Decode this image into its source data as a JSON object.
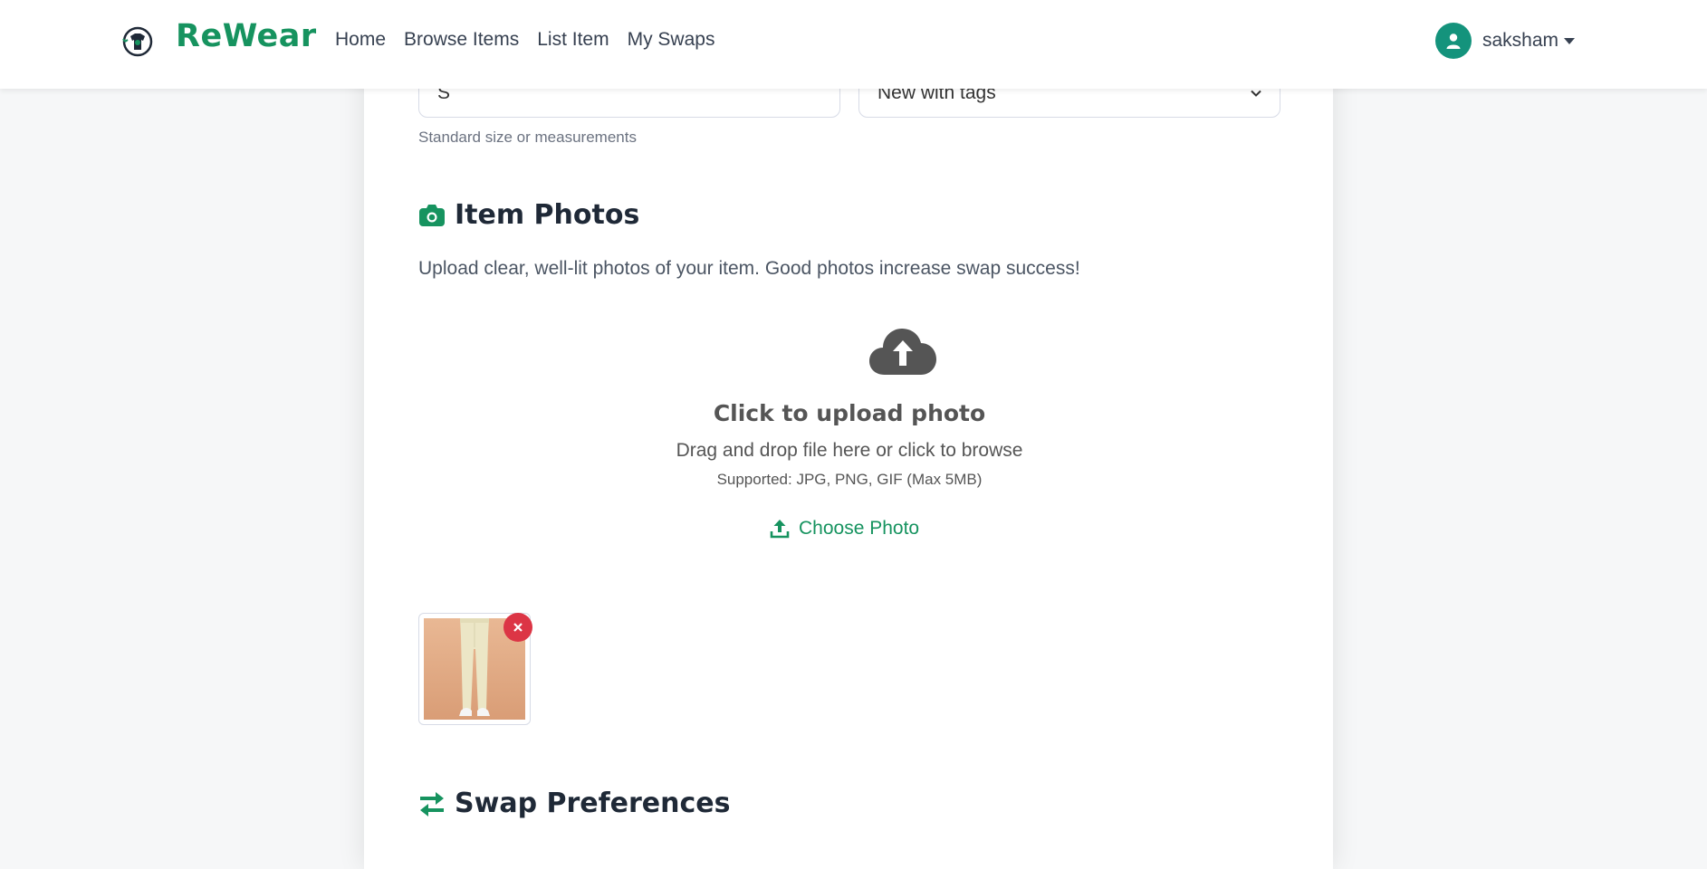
{
  "brand": {
    "name": "ReWear",
    "logo": "tshirt-recycle-logo"
  },
  "nav": {
    "links": [
      {
        "label": "Home"
      },
      {
        "label": "Browse Items"
      },
      {
        "label": "List Item"
      },
      {
        "label": "My Swaps"
      }
    ]
  },
  "user": {
    "name": "saksham",
    "icon": "user-avatar-icon"
  },
  "form": {
    "size": {
      "value": "S",
      "help": "Standard size or measurements"
    },
    "condition": {
      "value": "New with tags"
    }
  },
  "photos": {
    "title": "Item Photos",
    "icon": "camera-icon",
    "description": "Upload clear, well-lit photos of your item. Good photos increase swap success!",
    "upload": {
      "title": "Click to upload photo",
      "subtitle": "Drag and drop file here or click to browse",
      "formats": "Supported: JPG, PNG, GIF (Max 5MB)",
      "button_label": "Choose Photo"
    },
    "uploaded_count": 1
  },
  "swap": {
    "title": "Swap Preferences",
    "icon": "exchange-arrows-icon"
  },
  "colors": {
    "brand": "#16935f",
    "avatar": "#14937c",
    "remove": "#dc3545"
  }
}
